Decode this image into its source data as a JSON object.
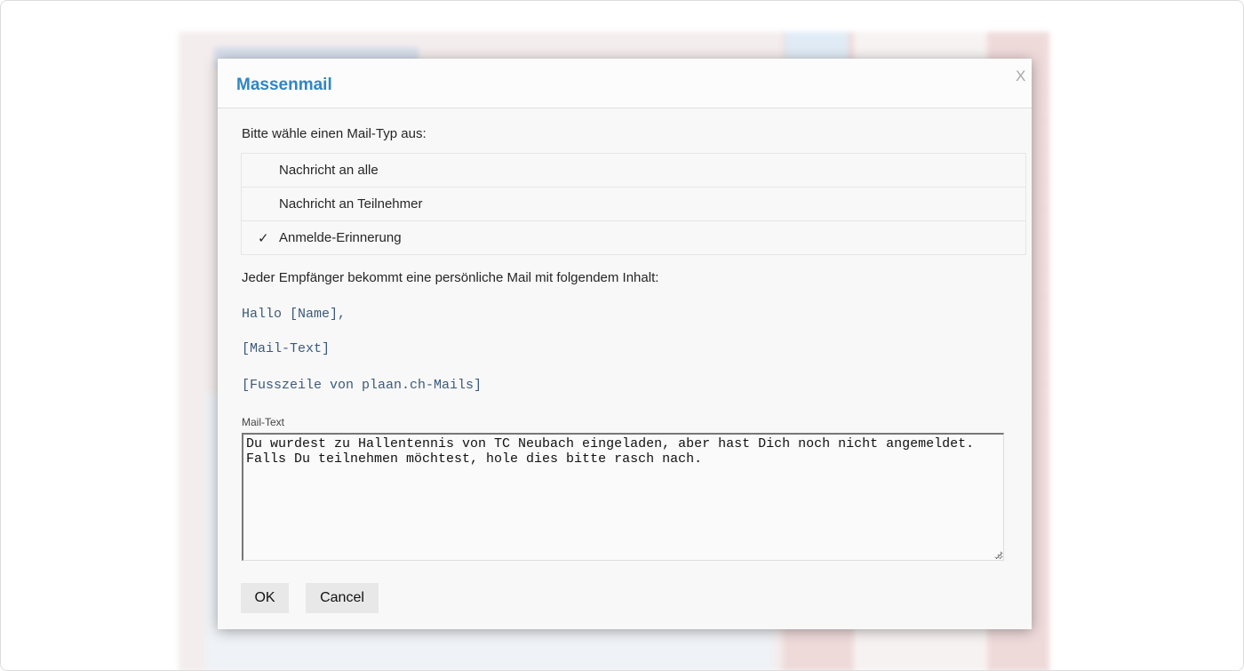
{
  "dialog": {
    "title": "Massenmail",
    "close_label": "X",
    "prompt": "Bitte wähle einen Mail-Typ aus:",
    "mail_types": [
      {
        "label": "Nachricht an alle",
        "selected": false
      },
      {
        "label": "Nachricht an Teilnehmer",
        "selected": false
      },
      {
        "label": "Anmelde-Erinnerung",
        "selected": true
      }
    ],
    "check_mark": "✓",
    "info": "Jeder Empfänger bekommt eine persönliche Mail mit folgendem Inhalt:",
    "preview": {
      "greeting": "Hallo [Name],",
      "body_placeholder": "[Mail-Text]",
      "footer_placeholder": "[Fusszeile von plaan.ch-Mails]"
    },
    "mail_text_label": "Mail-Text",
    "mail_text_value": "Du wurdest zu Hallentennis von TC Neubach eingeladen, aber hast Dich noch nicht angemeldet. Falls Du teilnehmen möchtest, hole dies bitte rasch nach.",
    "ok_label": "OK",
    "cancel_label": "Cancel"
  },
  "colors": {
    "title": "#2f86c4",
    "background_left": "#eee2e2",
    "background_right": "#e6c5c5"
  }
}
